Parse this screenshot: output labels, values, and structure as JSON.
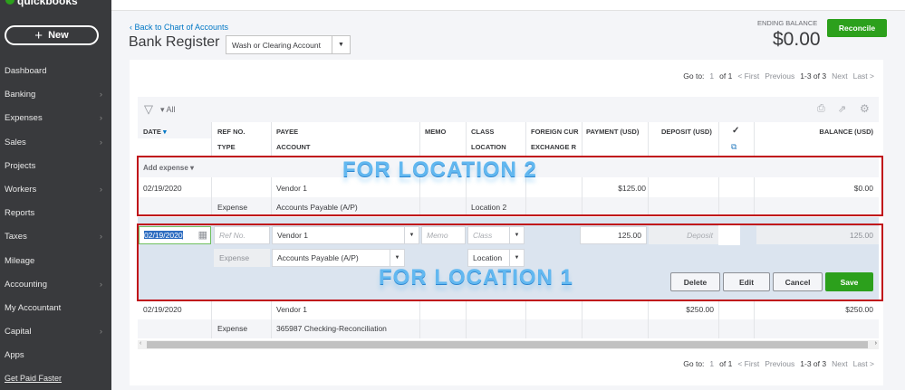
{
  "sidebar": {
    "logo": "quickbooks",
    "new_label": "New",
    "items": [
      {
        "label": "Dashboard",
        "chev": false
      },
      {
        "label": "Banking",
        "chev": true
      },
      {
        "label": "Expenses",
        "chev": true
      },
      {
        "label": "Sales",
        "chev": true
      },
      {
        "label": "Projects",
        "chev": false
      },
      {
        "label": "Workers",
        "chev": true
      },
      {
        "label": "Reports",
        "chev": false
      },
      {
        "label": "Taxes",
        "chev": true
      },
      {
        "label": "Mileage",
        "chev": false
      },
      {
        "label": "Accounting",
        "chev": true
      },
      {
        "label": "My Accountant",
        "chev": false
      },
      {
        "label": "Capital",
        "chev": true
      },
      {
        "label": "Apps",
        "chev": false
      }
    ],
    "footer_link": "Get Paid Faster"
  },
  "header": {
    "back_link": "Back to Chart of Accounts",
    "title": "Bank Register",
    "account": "Wash or Clearing Account",
    "ending_balance_label": "ENDING BALANCE",
    "ending_balance": "$0.00",
    "reconcile": "Reconcile"
  },
  "pager": {
    "goto": "Go to:",
    "page": "1",
    "of": "of 1",
    "first": "< First",
    "previous": "Previous",
    "range": "1-3 of 3",
    "next": "Next",
    "last": "Last >"
  },
  "filter": {
    "label": "All"
  },
  "columns": {
    "date": "DATE",
    "ref": "REF NO.",
    "type": "TYPE",
    "payee": "PAYEE",
    "account": "ACCOUNT",
    "memo": "MEMO",
    "class": "CLASS",
    "location": "LOCATION",
    "foreign": "FOREIGN CUR",
    "exchange": "EXCHANGE R",
    "payment": "PAYMENT (USD)",
    "deposit": "DEPOSIT (USD)",
    "check": "✓",
    "balance": "BALANCE (USD)"
  },
  "add_expense": "Add expense",
  "rows": [
    {
      "date": "02/19/2020",
      "payee": "Vendor 1",
      "payment": "$125.00",
      "deposit": "",
      "balance": "$0.00",
      "type": "Expense",
      "account": "Accounts Payable (A/P)",
      "location": "Location 2"
    },
    {
      "date": "02/19/2020",
      "payee": "Vendor 1",
      "payment": "",
      "deposit": "$250.00",
      "balance": "$250.00",
      "type": "Expense",
      "account": "365987 Checking-Reconciliation",
      "location": ""
    }
  ],
  "edit": {
    "date": "02/19/2020",
    "ref_placeholder": "Ref No.",
    "payee": "Vendor 1",
    "memo_placeholder": "Memo",
    "class_placeholder": "Class",
    "payment": "125.00",
    "deposit_placeholder": "Deposit",
    "balance": "125.00",
    "type": "Expense",
    "account": "Accounts Payable (A/P)",
    "location": "Location",
    "delete": "Delete",
    "edit": "Edit",
    "cancel": "Cancel",
    "save": "Save"
  },
  "annotations": {
    "top": "FOR LOCATION 2",
    "bottom": "FOR LOCATION 1"
  }
}
